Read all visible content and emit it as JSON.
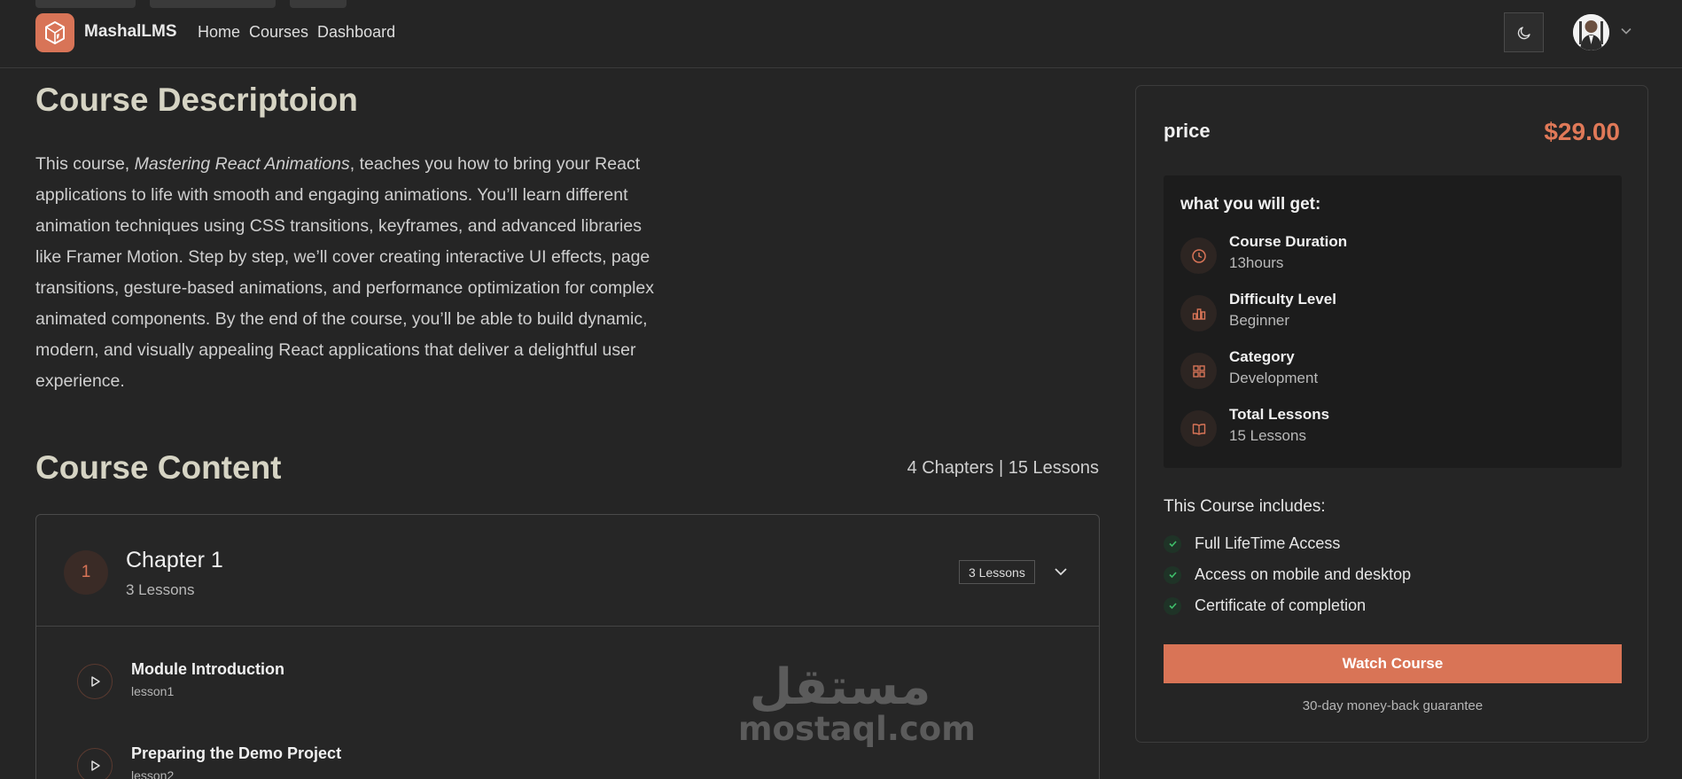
{
  "header": {
    "brand": "MashalLMS",
    "nav": [
      "Home",
      "Courses",
      "Dashboard"
    ],
    "accent": "#d87457"
  },
  "description": {
    "title": "Course Descriptoion",
    "text_before": "This course, ",
    "text_italic": "Mastering React Animations",
    "text_after": ", teaches you how to bring your React applications to life with smooth and engaging animations. You’ll learn different animation techniques using CSS transitions, keyframes, and advanced libraries like Framer Motion. Step by step, we’ll cover creating interactive UI effects, page transitions, gesture-based animations, and performance optimization for complex animated components. By the end of the course, you’ll be able to build dynamic, modern, and visually appealing React applications that deliver a delightful user experience."
  },
  "content": {
    "title": "Course Content",
    "summary": "4 Chapters | 15 Lessons",
    "chapter": {
      "number": "1",
      "title": "Chapter 1",
      "subtitle": "3 Lessons",
      "badge": "3 Lessons"
    },
    "lessons": [
      {
        "title": "Module Introduction",
        "subtitle": "lesson1"
      },
      {
        "title": "Preparing the Demo Project",
        "subtitle": "lesson2"
      }
    ]
  },
  "watermark": {
    "arabic": "مستقل",
    "latin": "mostaql.com"
  },
  "card": {
    "price_label": "price",
    "price_value": "$29.00",
    "get_title": "what you will get:",
    "get_items": [
      {
        "label": "Course Duration",
        "value": "13hours",
        "icon": "clock-icon"
      },
      {
        "label": "Difficulty Level",
        "value": "Beginner",
        "icon": "chart-bar-icon"
      },
      {
        "label": "Category",
        "value": "Development",
        "icon": "grid-icon"
      },
      {
        "label": "Total Lessons",
        "value": "15 Lessons",
        "icon": "book-icon"
      }
    ],
    "includes_title": "This Course includes:",
    "includes": [
      "Full LifeTime Access",
      "Access on mobile and desktop",
      "Certificate of completion"
    ],
    "watch_button": "Watch Course",
    "guarantee": "30-day money-back guarantee"
  }
}
